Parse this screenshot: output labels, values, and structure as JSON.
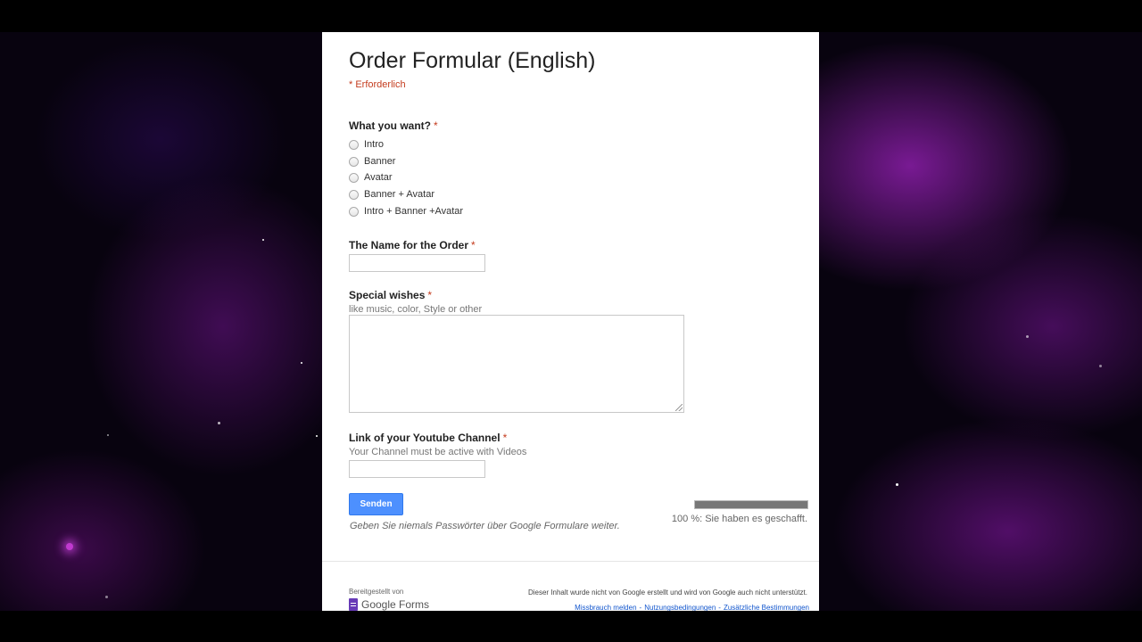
{
  "form": {
    "title": "Order Formular (English)",
    "required_note": "* Erforderlich",
    "required_mark": "*",
    "questions": {
      "what_you_want": {
        "label": "What you want?",
        "options": [
          "Intro",
          "Banner",
          "Avatar",
          "Banner + Avatar",
          "Intro + Banner +Avatar"
        ]
      },
      "order_name": {
        "label": "The Name for the Order",
        "value": ""
      },
      "special_wishes": {
        "label": "Special wishes",
        "help": "like music, color, Style or other",
        "value": ""
      },
      "youtube_link": {
        "label": "Link of your Youtube Channel",
        "help": "Your Channel must be active with Videos",
        "value": ""
      }
    },
    "submit_label": "Senden",
    "password_warning": "Geben Sie niemals Passwörter über Google Formulare weiter.",
    "progress": {
      "fraction": 1.0,
      "text": "100 %: Sie haben es geschafft."
    }
  },
  "footer": {
    "powered_by": "Bereitgestellt von",
    "logo_text": "Google Forms",
    "disclaimer": "Dieser Inhalt wurde nicht von Google erstellt und wird von Google auch nicht unterstützt.",
    "links": [
      "Missbrauch melden",
      "Nutzungsbedingungen",
      "Zusätzliche Bestimmungen"
    ],
    "link_separator": "-"
  },
  "colors": {
    "required": "#c43b1d",
    "submit_button": "#4d90fe",
    "link": "#1155cc",
    "logo": "#673ab7"
  },
  "icons": {
    "forms_logo": "google-forms-icon"
  }
}
